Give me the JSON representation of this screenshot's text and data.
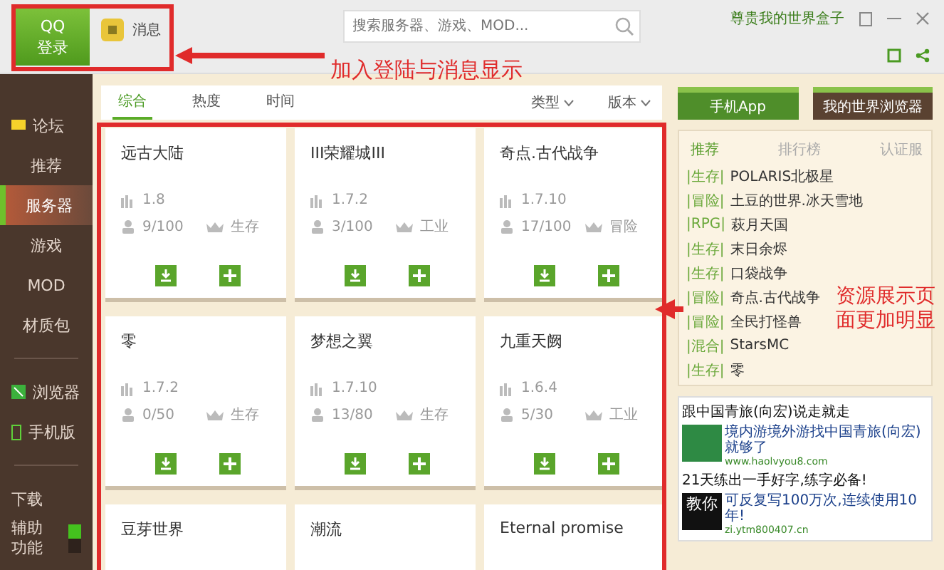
{
  "header": {
    "login": {
      "line1": "QQ",
      "line2": "登录"
    },
    "messages": "消息",
    "search": {
      "placeholder": "搜索服务器、游戏、MOD..."
    },
    "account": "尊贵我的世界盒子"
  },
  "sidebar": {
    "groups": [
      [
        {
          "label": "论坛",
          "kind": "forum",
          "selected": false
        },
        {
          "label": "推荐",
          "kind": "plain",
          "selected": false
        },
        {
          "label": "服务器",
          "kind": "plain",
          "selected": true
        },
        {
          "label": "游戏",
          "kind": "plain",
          "selected": false
        },
        {
          "label": "MOD",
          "kind": "plain",
          "selected": false
        },
        {
          "label": "材质包",
          "kind": "plain",
          "selected": false
        }
      ],
      [
        {
          "label": "浏览器",
          "kind": "browser",
          "selected": false
        },
        {
          "label": "手机版",
          "kind": "phone",
          "selected": false
        }
      ],
      [
        {
          "label": "下载",
          "kind": "plain",
          "selected": false
        },
        {
          "label": "辅助功能",
          "kind": "toggle",
          "selected": false,
          "on": true
        }
      ]
    ]
  },
  "filters": {
    "tabs": [
      {
        "label": "综合",
        "selected": true
      },
      {
        "label": "热度",
        "selected": false
      },
      {
        "label": "时间",
        "selected": false
      }
    ],
    "dropdowns": [
      "类型",
      "版本"
    ]
  },
  "cards": [
    {
      "title": "远古大陆",
      "version": "1.8",
      "players": "9/100",
      "mode": "生存"
    },
    {
      "title": "III荣耀城III",
      "version": "1.7.2",
      "players": "3/100",
      "mode": "工业"
    },
    {
      "title": "奇点.古代战争",
      "version": "1.7.10",
      "players": "17/100",
      "mode": "冒险"
    },
    {
      "title": "零",
      "version": "1.7.2",
      "players": "0/50",
      "mode": "生存"
    },
    {
      "title": "梦想之翼",
      "version": "1.7.10",
      "players": "13/80",
      "mode": "生存"
    },
    {
      "title": "九重天阙",
      "version": "1.6.4",
      "players": "5/30",
      "mode": "工业"
    },
    {
      "title": "豆芽世界"
    },
    {
      "title": "潮流"
    },
    {
      "title": "Eternal promise"
    }
  ],
  "side_buttons": [
    {
      "label": "手机App",
      "kind": "green"
    },
    {
      "label": "我的世界浏览器",
      "kind": "brown"
    }
  ],
  "ranking": {
    "tabs": [
      {
        "label": "推荐",
        "selected": true
      },
      {
        "label": "排行榜",
        "selected": false
      },
      {
        "label": "认证服",
        "selected": false
      }
    ],
    "items": [
      {
        "tag": "|生存|",
        "name": "POLARIS北极星"
      },
      {
        "tag": "|冒险|",
        "name": "土豆的世界.冰天雪地"
      },
      {
        "tag": "|RPG|",
        "name": "萩月天国"
      },
      {
        "tag": "|生存|",
        "name": "末日余烬"
      },
      {
        "tag": "|生存|",
        "name": "口袋战争"
      },
      {
        "tag": "|冒险|",
        "name": "奇点.古代战争"
      },
      {
        "tag": "|冒险|",
        "name": "全民打怪兽"
      },
      {
        "tag": "|混合|",
        "name": "StarsMC"
      },
      {
        "tag": "|生存|",
        "name": "零"
      }
    ]
  },
  "ads": [
    {
      "title": "跟中国青旅(向宏)说走就走",
      "text": "境内游境外游找中国青旅(向宏)就够了",
      "url": "www.haolvyou8.com",
      "kind": "picture"
    },
    {
      "title": "21天练出一手好字,练字必备!",
      "text": "可反复写100万次,连续使用10年!",
      "url": "zi.ytm800407.cn",
      "kind": "text",
      "logo_text": "教你"
    }
  ],
  "annotations": [
    {
      "text": "加入登陆与消息显示"
    },
    {
      "text": "资源展示页面更加明显"
    }
  ]
}
